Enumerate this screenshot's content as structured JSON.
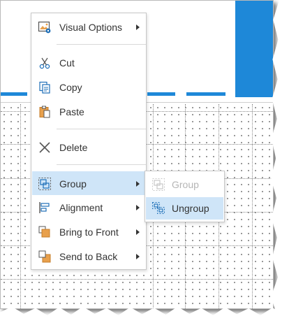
{
  "context_menu": {
    "items": [
      {
        "label": "Visual Options",
        "icon": "visual-options-icon",
        "has_submenu": true
      },
      {
        "label": "Cut",
        "icon": "scissors-icon"
      },
      {
        "label": "Copy",
        "icon": "copy-icon"
      },
      {
        "label": "Paste",
        "icon": "paste-icon"
      },
      {
        "label": "Delete",
        "icon": "delete-x-icon"
      },
      {
        "label": "Group",
        "icon": "group-icon",
        "has_submenu": true,
        "highlighted": true
      },
      {
        "label": "Alignment",
        "icon": "alignment-icon",
        "has_submenu": true
      },
      {
        "label": "Bring to Front",
        "icon": "bring-to-front-icon",
        "has_submenu": true
      },
      {
        "label": "Send to Back",
        "icon": "send-to-back-icon",
        "has_submenu": true
      }
    ]
  },
  "group_submenu": {
    "items": [
      {
        "label": "Group",
        "icon": "group-icon",
        "disabled": true
      },
      {
        "label": "Ungroup",
        "icon": "ungroup-icon",
        "highlighted": true
      }
    ]
  },
  "colors": {
    "accent_blue": "#1e88d8",
    "highlight": "#cfe5f8",
    "icon_orange": "#e8a04c"
  }
}
